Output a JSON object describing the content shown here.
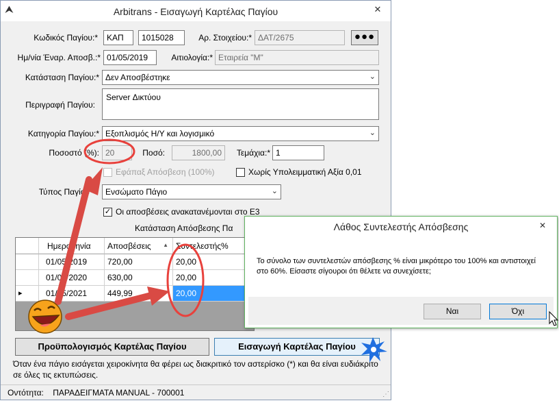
{
  "window": {
    "title": "Arbitrans - Εισαγωγή Καρτέλας Παγίου",
    "close_glyph": "✕"
  },
  "form": {
    "code_label": "Κωδικός Παγίου:*",
    "code_prefix": "ΚΑΠ",
    "code_number": "1015028",
    "item_no_label": "Αρ. Στοιχείου:*",
    "item_no_value": "ΔΑΤ/2675",
    "more_button": "●●●",
    "start_date_label": "Ημ/νία Έναρ. Αποσβ.:*",
    "start_date_value": "01/05/2019",
    "reason_label": "Αιτιολογία:*",
    "reason_value": "Εταιρεία \"Μ\"",
    "status_label": "Κατάσταση Παγίου:*",
    "status_value": "Δεν Αποσβέστηκε",
    "description_label": "Περιγραφή Παγίου:",
    "description_value": "Server Δικτύου",
    "category_label": "Κατηγορία Παγίου:*",
    "category_value": "Εξοπλισμός Η/Υ και λογισμικό",
    "percent_label": "Ποσοστό (%):",
    "percent_value": "20",
    "amount_label": "Ποσό:",
    "amount_value": "1800,00",
    "pieces_label": "Τεμάχια:*",
    "pieces_value": "1",
    "lump_sum_label": "Εφάπαξ Απόσβεση (100%)",
    "no_residual_label": "Χωρίς Υπολειμματική Αξία 0,01",
    "type_label": "Τύπος Παγίου",
    "type_value": "Ενσώματο Πάγιο",
    "e3_label": "Οι αποσβέσεις ανακατανέμονται στο Ε3",
    "e3_check": "✓",
    "depreciation_status_label": "Κατάσταση Απόσβεσης Πα"
  },
  "grid": {
    "headers": [
      "Ημερομηνία",
      "Αποσβέσεις",
      "Συντελεστής%"
    ],
    "sort_glyph": "▲",
    "row_marker": "▸",
    "rows": [
      [
        "01/05/2019",
        "720,00",
        "20,00"
      ],
      [
        "01/05/2020",
        "630,00",
        "20,00"
      ],
      [
        "01/05/2021",
        "449,99",
        "20,00"
      ]
    ]
  },
  "buttons": {
    "budget": "Προϋπολογισμός Καρτέλας Παγίου",
    "insert": "Εισαγωγή Καρτέλας Παγίου"
  },
  "note": "Όταν ένα πάγιο εισάγεται χειροκίνητα θα φέρει ως διακριτικό τον αστερίσκο (*) και θα είναι ευδιάκριτο σε όλες τις εκτυπώσεις.",
  "status": {
    "entity_label": "Οντότητα:",
    "entity_value": "ΠΑΡΑΔΕΙΓΜΑΤΑ MANUAL  -  700001"
  },
  "dialog": {
    "title": "Λάθος Συντελεστής Απόσβεσης",
    "close_glyph": "✕",
    "message": "Το σύνολο των συντελεστών απόσβεσης % είναι μικρότερο του 100% και αντιστοιχεί στο 60%. Είσαστε σίγουροι ότι θέλετε να συνεχίσετε;",
    "yes": "Ναι",
    "no": "Όχι"
  },
  "colors": {
    "selection": "#3399ff",
    "annotation_red": "#e8413c",
    "dialog_border": "#5fb25f"
  }
}
